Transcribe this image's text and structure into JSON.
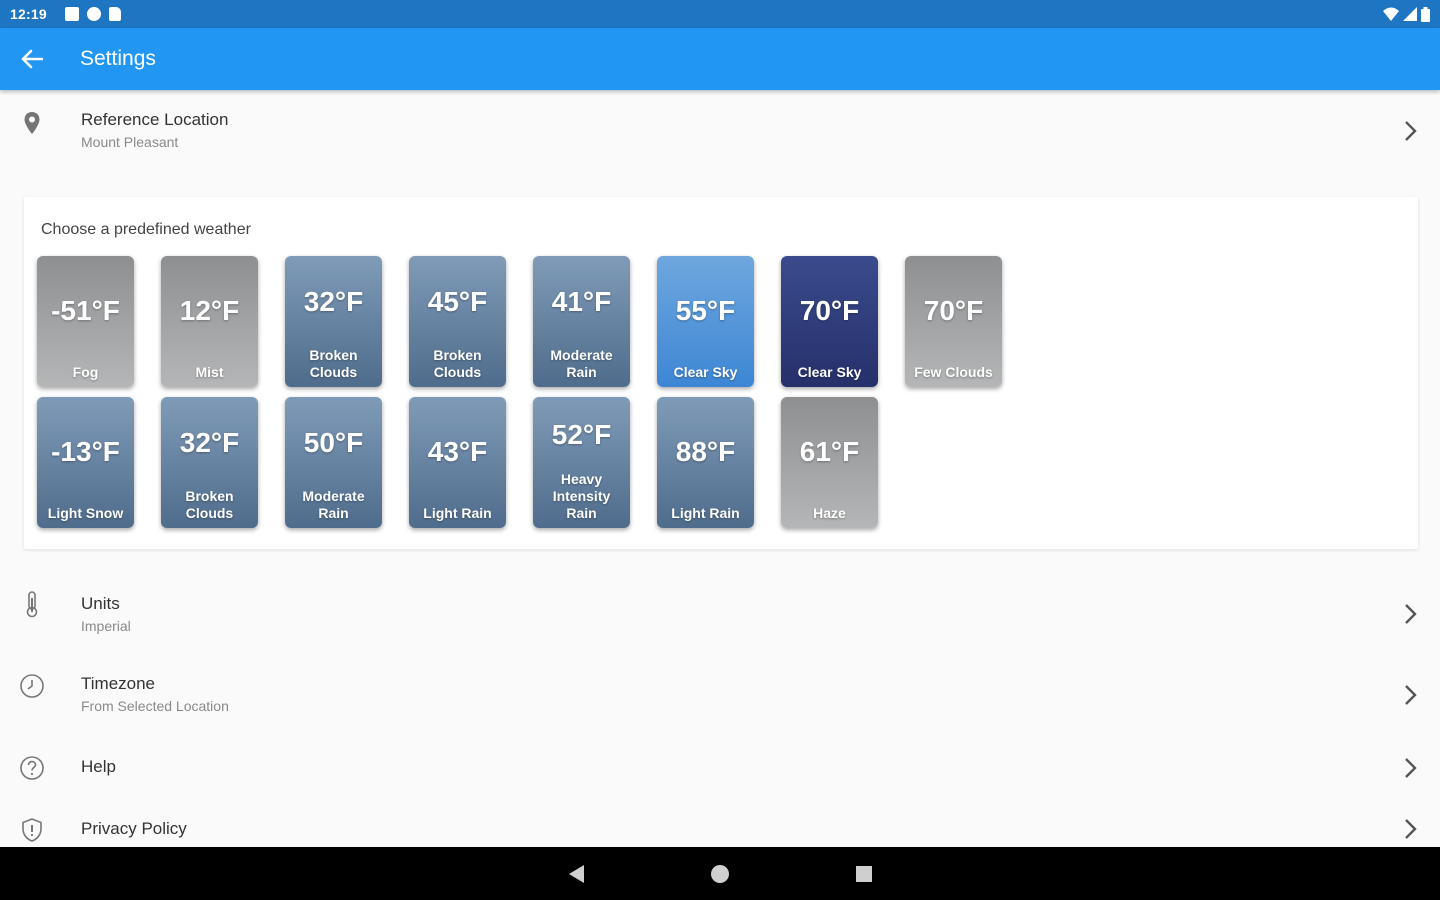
{
  "status_bar": {
    "time": "12:19"
  },
  "app_bar": {
    "title": "Settings"
  },
  "reference_location": {
    "title": "Reference Location",
    "value": "Mount Pleasant"
  },
  "weather": {
    "heading": "Choose a predefined weather",
    "tiles": [
      {
        "temp": "-51°F",
        "condition": "Fog",
        "style": "gray"
      },
      {
        "temp": "12°F",
        "condition": "Mist",
        "style": "gray"
      },
      {
        "temp": "32°F",
        "condition": "Broken Clouds",
        "style": "slate"
      },
      {
        "temp": "45°F",
        "condition": "Broken Clouds",
        "style": "slate"
      },
      {
        "temp": "41°F",
        "condition": "Moderate Rain",
        "style": "slate"
      },
      {
        "temp": "55°F",
        "condition": "Clear Sky",
        "style": "blue"
      },
      {
        "temp": "70°F",
        "condition": "Clear Sky",
        "style": "navy"
      },
      {
        "temp": "70°F",
        "condition": "Few Clouds",
        "style": "gray"
      },
      {
        "temp": "-13°F",
        "condition": "Light Snow",
        "style": "slate"
      },
      {
        "temp": "32°F",
        "condition": "Broken Clouds",
        "style": "slate"
      },
      {
        "temp": "50°F",
        "condition": "Moderate Rain",
        "style": "slate"
      },
      {
        "temp": "43°F",
        "condition": "Light Rain",
        "style": "slate"
      },
      {
        "temp": "52°F",
        "condition": "Heavy Intensity Rain",
        "style": "slate"
      },
      {
        "temp": "88°F",
        "condition": "Light Rain",
        "style": "slate"
      },
      {
        "temp": "61°F",
        "condition": "Haze",
        "style": "gray"
      }
    ]
  },
  "units": {
    "title": "Units",
    "value": "Imperial"
  },
  "timezone": {
    "title": "Timezone",
    "value": "From Selected Location"
  },
  "help": {
    "title": "Help"
  },
  "privacy": {
    "title": "Privacy Policy"
  },
  "colors": {
    "status_bar": "#1e76c2",
    "app_bar": "#2196f3",
    "background": "#fafafa"
  }
}
